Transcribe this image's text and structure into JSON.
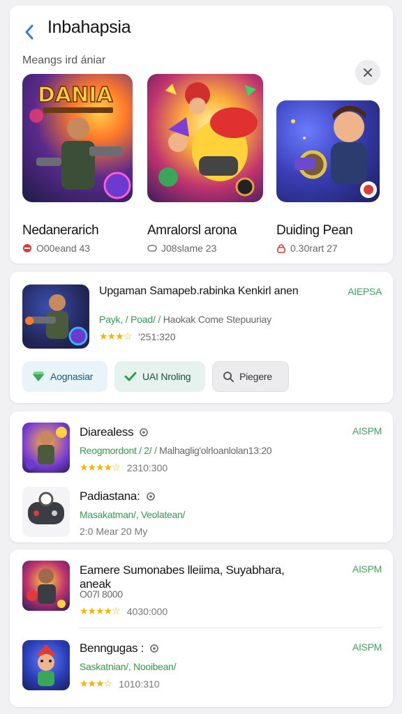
{
  "header": {
    "title": "Inbahapsia",
    "back_icon": "chevron-left-icon",
    "section_label": "Meangs ird ániar",
    "close_icon": "close-icon"
  },
  "featured": [
    {
      "name": "Nedanerarich",
      "meta": "O00eand 43",
      "badge_color": "#e03a3a",
      "art_label": "DANIA"
    },
    {
      "name": "Amralorsl arona",
      "meta": "J08slame 23",
      "badge_color": "#777777"
    },
    {
      "name": "Duiding Pean",
      "meta": "0.30rart 27",
      "badge_color": "#e03a3a"
    }
  ],
  "detail": {
    "title": "Upgaman Samapeb.rabinka Kenkirl anen",
    "sub_green": "Payk, / Poad/ / ",
    "sub_rest": "Haokak Come Stepuuriay",
    "stars": "★★★☆",
    "rating_text": "'251:320",
    "tag": "AIEPSA",
    "chips": [
      {
        "label": "Aognasiar",
        "icon": "gem-icon"
      },
      {
        "label": "UAI Nroling",
        "icon": "check-icon"
      },
      {
        "label": "Piegere",
        "icon": "search-icon"
      }
    ]
  },
  "list1": [
    {
      "name": "Diarealess",
      "sub_green": "Reogmordont / 2/ / ",
      "sub_rest": "Malhaglig'olrloanlolan13:20",
      "stars": "★★★★☆",
      "rating_text": "2310:300",
      "tag": "AISPM"
    },
    {
      "name": "Padiastana:",
      "sub_green": "Masakatman/, Veolatean/",
      "sub_rest": "",
      "rating_text": "2:0 Mear 20 My",
      "tag": ""
    }
  ],
  "list2": [
    {
      "name": "Eamere Sumonabes lleiima, Suyabhara, aneak",
      "sub_plain": "O07l 8000",
      "stars": "★★★★☆",
      "rating_text": "4030:000",
      "tag": "AISPM"
    },
    {
      "name": "Benngugas :",
      "sub_green": "Saskatnian/, Nooibean/",
      "stars": "★★★☆",
      "rating_text": "1010:310",
      "tag": "AISPM"
    }
  ],
  "colors": {
    "accent_blue": "#2f7fd6",
    "tag_green": "#3aa65a",
    "star_gold": "#f4b400"
  }
}
